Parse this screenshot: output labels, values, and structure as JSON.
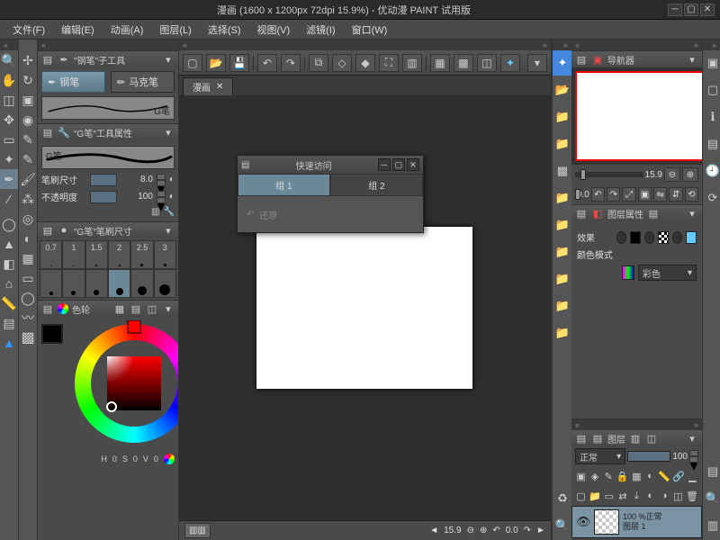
{
  "title": "漫画 (1600 x 1200px 72dpi 15.9%)  - 优动漫 PAINT 试用版",
  "menu": [
    "文件(F)",
    "编辑(E)",
    "动画(A)",
    "图层(L)",
    "选择(S)",
    "视图(V)",
    "滤镜(I)",
    "窗口(W)"
  ],
  "subtool_header": "\"钢笔\"子工具",
  "subtool_pen": "钢笔",
  "subtool_marker": "马克笔",
  "subtool_sublabel": "G笔",
  "toolprops_header": "\"G笔\"工具属性",
  "toolprops_sublabel": "G笔",
  "brush_size_label": "笔刷尺寸",
  "brush_size_value": "8.0",
  "opacity_label": "不透明度",
  "opacity_value": "100",
  "brushsize_header": "\"G笔\"笔刷尺寸",
  "brush_sizes": [
    "0.7",
    "1",
    "1.5",
    "2",
    "2.5",
    "3"
  ],
  "color_header": "色轮",
  "color_footer_H": "H",
  "color_footer_S": "S",
  "color_footer_V": "V",
  "color_H_val": "0",
  "color_S_val": "0",
  "color_V_val": "0",
  "doc_tab": "漫画",
  "status_zoom": "15.9",
  "status_rot": "0.0",
  "navigator_header": "导航器",
  "nav_zoom": "15.9",
  "nav_rot": "0.0",
  "layerprops_header": "图层属性",
  "layerprops_effect": "效果",
  "layerprops_colormode": "颜色模式",
  "layerprops_colormode_val": "彩色",
  "layers_header": "图层",
  "layer_blend": "正常",
  "layer_opacity": "100",
  "layer_item_opacity": "100 %",
  "layer_item_blend": "正常",
  "layer_item_name": "图层 1",
  "dialog_title": "快速访问",
  "dialog_tab1": "组 1",
  "dialog_tab2": "组 2",
  "dialog_restore": "还原"
}
